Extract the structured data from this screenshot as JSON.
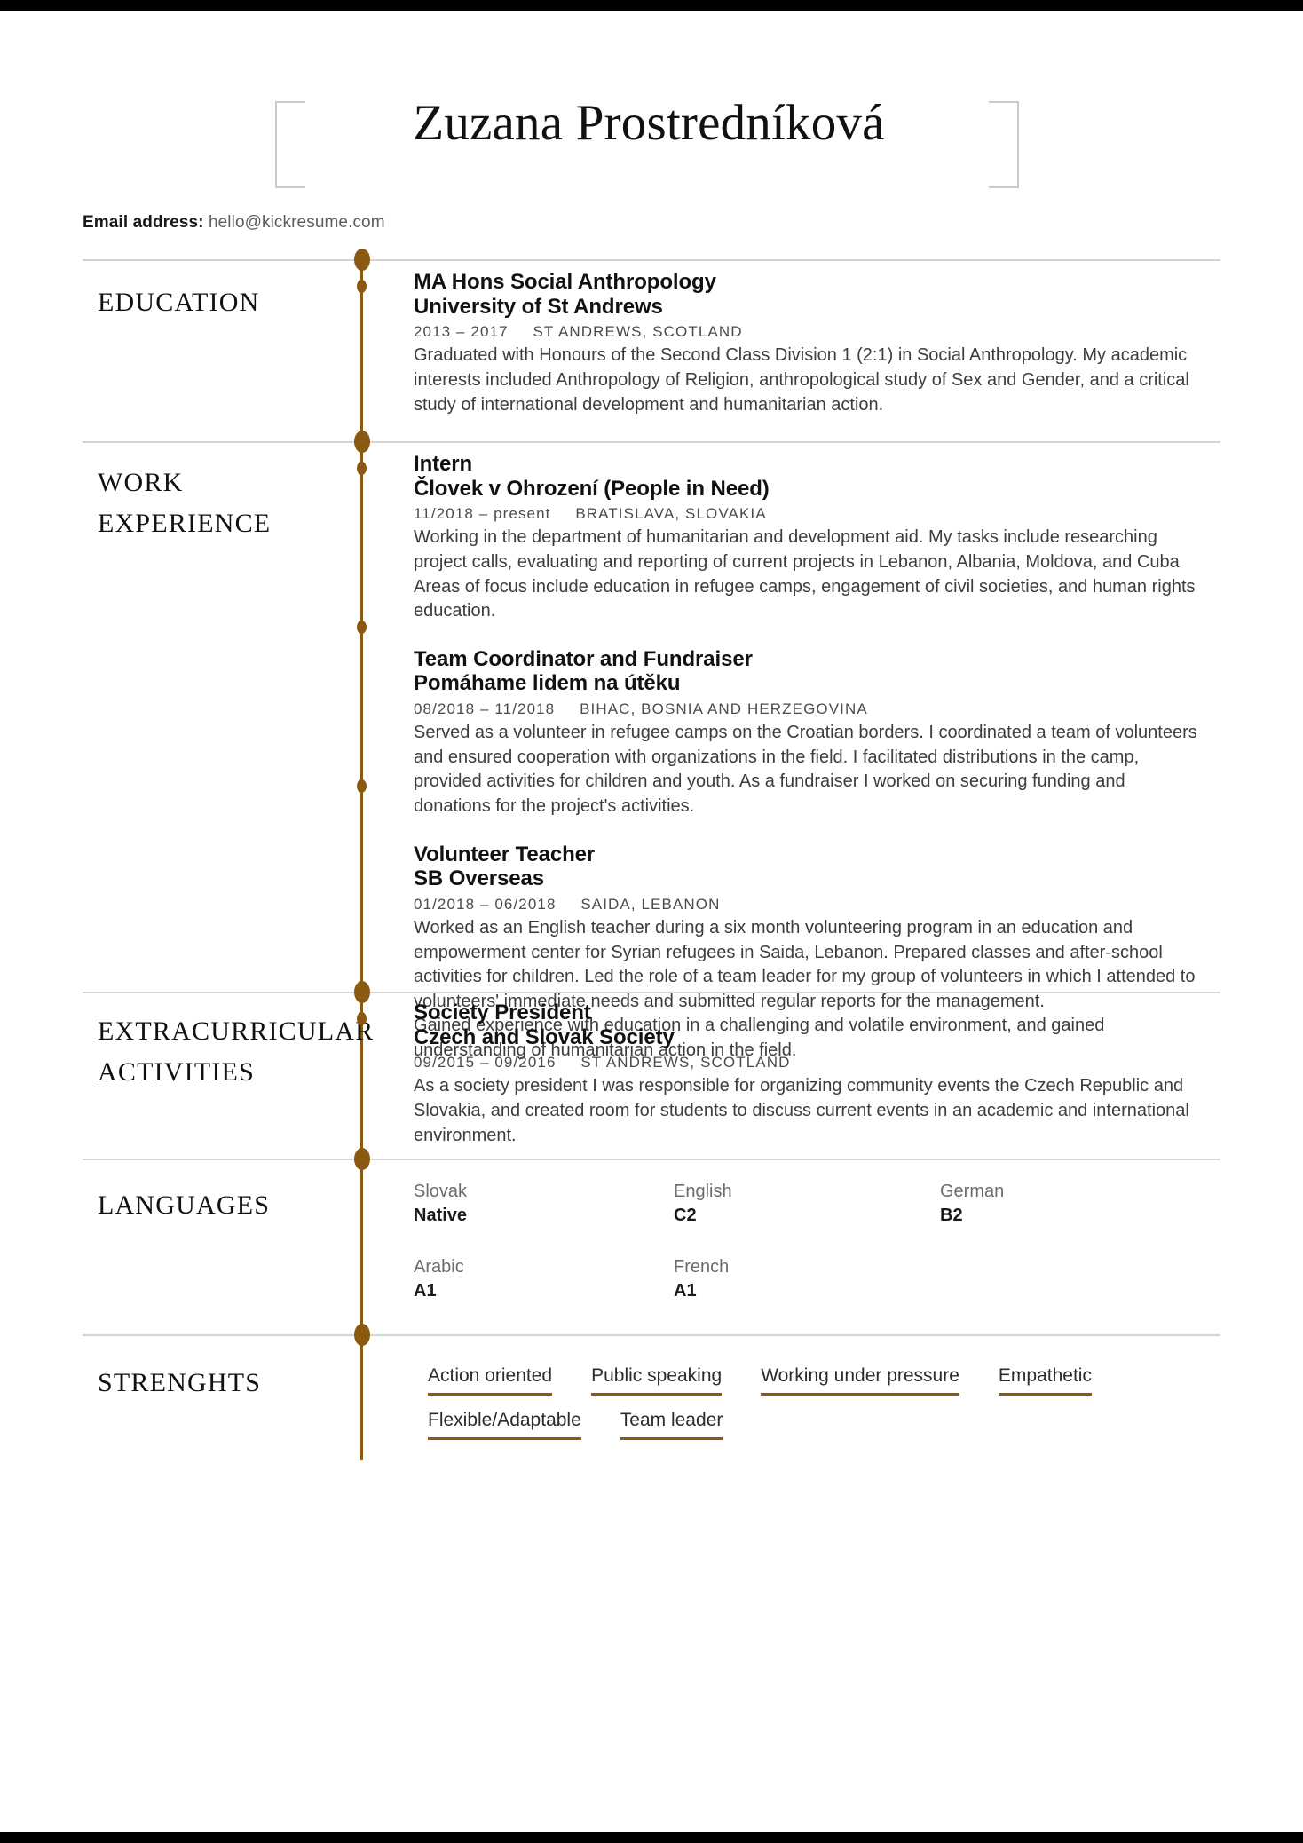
{
  "accent_color": "#8a5a12",
  "rule_color": "#d4d4d4",
  "header": {
    "name": "Zuzana Prostredníková",
    "contact_label": "Email address:",
    "contact_value": "hello@kickresume.com"
  },
  "sections": {
    "education": {
      "label": "EDUCATION",
      "entries": [
        {
          "title": "MA Hons Social Anthropology",
          "org": "University of St Andrews",
          "dates": "2013 – 2017",
          "place": "ST ANDREWS, SCOTLAND",
          "desc": "Graduated with Honours of the Second Class Division 1 (2:1) in Social Anthropology. My academic interests included Anthropology of Religion, anthropological study of Sex and Gender, and a critical study of international development and humanitarian action."
        }
      ]
    },
    "work": {
      "label_line1": "WORK",
      "label_line2": "EXPERIENCE",
      "entries": [
        {
          "title": "Intern",
          "org": "Človek v Ohrození (People in Need)",
          "dates": "11/2018 – present",
          "place": "BRATISLAVA, SLOVAKIA",
          "desc": "Working in the department of humanitarian and development aid. My tasks include researching project calls, evaluating and reporting of current projects in Lebanon, Albania, Moldova, and Cuba Areas of focus include education in refugee camps, engagement of civil societies, and human rights education."
        },
        {
          "title": "Team Coordinator and Fundraiser",
          "org": "Pomáhame lidem na útěku",
          "dates": "08/2018 – 11/2018",
          "place": "BIHAC, BOSNIA AND HERZEGOVINA",
          "desc": "Served as a volunteer in refugee camps on the Croatian borders. I coordinated a team of volunteers and ensured cooperation with organizations in the field. I facilitated distributions in the camp, provided activities for children and youth. As a fundraiser I worked on securing funding and donations for the project's activities."
        },
        {
          "title": "Volunteer Teacher",
          "org": "SB Overseas",
          "dates": "01/2018 – 06/2018",
          "place": "SAIDA, LEBANON",
          "desc": "Worked as an English teacher during a six month volunteering program in an education and empowerment center for Syrian refugees in Saida, Lebanon. Prepared classes and after-school activities for children. Led the role of a team leader for my group of volunteers in which I attended to volunteers' immediate needs and submitted regular reports for the management.",
          "desc2": "Gained experience with education in a challenging and volatile environment, and gained understanding of humanitarian action in the field."
        }
      ]
    },
    "extracurricular": {
      "label_line1": "EXTRACURRICULAR",
      "label_line2": "ACTIVITIES",
      "entries": [
        {
          "title": "Society President",
          "org": "Czech and Slovak Society",
          "dates": "09/2015 – 09/2016",
          "place": "ST ANDREWS, SCOTLAND",
          "desc": "As a society president I was responsible for organizing community events  the Czech Republic and Slovakia, and created room for students to discuss current events in an academic and international environment."
        }
      ]
    },
    "languages": {
      "label": "LANGUAGES",
      "items": [
        {
          "name": "Slovak",
          "level": "Native"
        },
        {
          "name": "English",
          "level": "C2"
        },
        {
          "name": "German",
          "level": "B2"
        },
        {
          "name": "Arabic",
          "level": "A1"
        },
        {
          "name": "French",
          "level": "A1"
        }
      ]
    },
    "strengths": {
      "label": "STRENGHTS",
      "items": [
        "Action oriented",
        "Public speaking",
        "Working under pressure",
        "Empathetic",
        "Flexible/Adaptable",
        "Team leader"
      ]
    }
  }
}
